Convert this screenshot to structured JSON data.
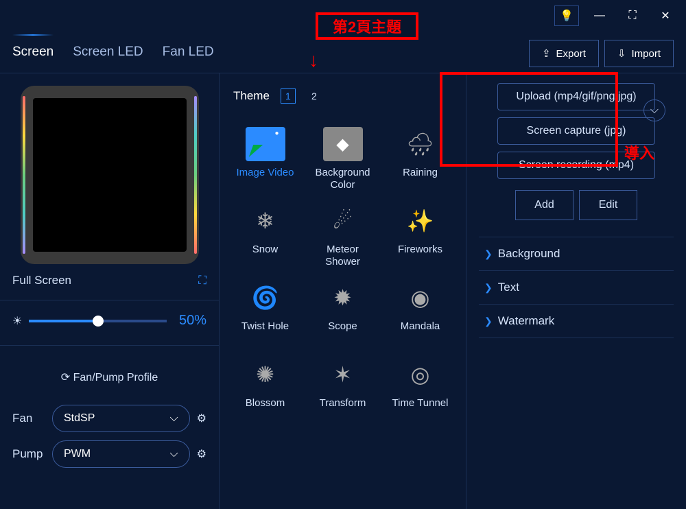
{
  "annot": {
    "title": "第2頁主題",
    "import_label": "導入"
  },
  "titlebar": {
    "tip": "tip"
  },
  "tabs": {
    "screen": "Screen",
    "screen_led": "Screen LED",
    "fan_led": "Fan LED"
  },
  "io": {
    "export": "Export",
    "import": "Import"
  },
  "left": {
    "fullscreen": "Full Screen",
    "brightness_pct": "50%",
    "profile": "Fan/Pump Profile",
    "fan_label": "Fan",
    "fan_value": "StdSP",
    "pump_label": "Pump",
    "pump_value": "PWM"
  },
  "mid": {
    "theme_label": "Theme",
    "t1": "1",
    "t2": "2",
    "effects": [
      "Image Video",
      "Background Color",
      "Raining",
      "Snow",
      "Meteor Shower",
      "Fireworks",
      "Twist Hole",
      "Scope",
      "Mandala",
      "Blossom",
      "Transform",
      "Time Tunnel"
    ]
  },
  "right": {
    "upload": "Upload (mp4/gif/png/jpg)",
    "capture": "Screen capture (jpg)",
    "record": "Screen recording (mp4)",
    "add": "Add",
    "edit": "Edit",
    "acc": {
      "background": "Background",
      "text": "Text",
      "watermark": "Watermark"
    }
  }
}
